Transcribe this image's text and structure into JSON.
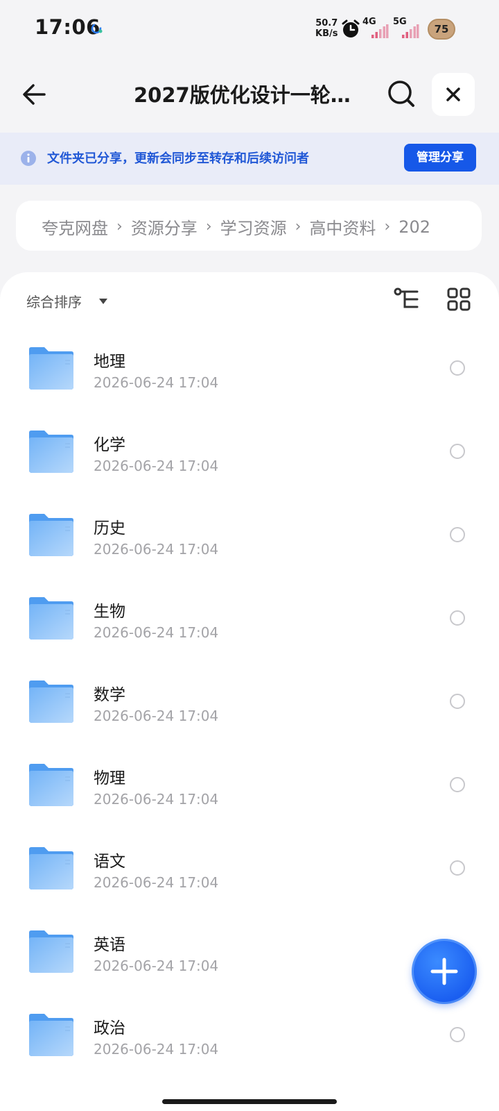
{
  "status_bar": {
    "time": "17:06",
    "net_speed_value": "50.7",
    "net_speed_unit": "KB/s",
    "signal_1": "4G",
    "signal_2": "5G",
    "battery": "75"
  },
  "header": {
    "title": "2027版优化设计一轮…"
  },
  "share_banner": {
    "text": "文件夹已分享，更新会同步至转存和后续访问者",
    "button": "管理分享"
  },
  "breadcrumb": [
    "夸克网盘",
    "资源分享",
    "学习资源",
    "高中资料",
    "202"
  ],
  "toolbar": {
    "sort_label": "综合排序"
  },
  "files": [
    {
      "name": "地理",
      "date": "2026-06-24 17:04"
    },
    {
      "name": "化学",
      "date": "2026-06-24 17:04"
    },
    {
      "name": "历史",
      "date": "2026-06-24 17:04"
    },
    {
      "name": "生物",
      "date": "2026-06-24 17:04"
    },
    {
      "name": "数学",
      "date": "2026-06-24 17:04"
    },
    {
      "name": "物理",
      "date": "2026-06-24 17:04"
    },
    {
      "name": "语文",
      "date": "2026-06-24 17:04"
    },
    {
      "name": "英语",
      "date": "2026-06-24 17:04"
    },
    {
      "name": "政治",
      "date": "2026-06-24 17:04"
    }
  ],
  "colors": {
    "accent": "#1658e8",
    "banner_bg": "#e9ecf8",
    "banner_text": "#2158d6"
  },
  "icons": [
    "back-arrow-icon",
    "search-icon",
    "close-icon",
    "info-icon",
    "tree-view-icon",
    "grid-view-icon",
    "folder-icon",
    "plus-icon"
  ]
}
